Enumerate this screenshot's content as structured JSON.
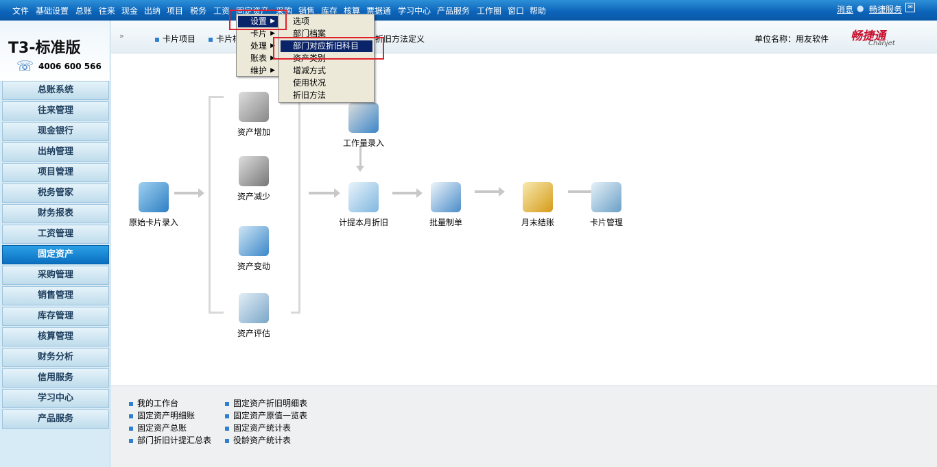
{
  "menubar": {
    "items": [
      "文件",
      "基础设置",
      "总账",
      "往来",
      "现金",
      "出纳",
      "项目",
      "税务",
      "工资",
      "固定资产",
      "采购",
      "销售",
      "库存",
      "核算",
      "票据通",
      "学习中心",
      "产品服务",
      "工作圈",
      "窗口",
      "帮助"
    ],
    "msg": "消息",
    "service": "畅捷服务"
  },
  "logo": {
    "title": "T3-标准版",
    "phone": "4006 600 566"
  },
  "sidebar": {
    "items": [
      "总账系统",
      "往来管理",
      "现金银行",
      "出纳管理",
      "项目管理",
      "税务管家",
      "财务报表",
      "工资管理",
      "固定资产",
      "采购管理",
      "销售管理",
      "库存管理",
      "核算管理",
      "财务分析",
      "信用服务",
      "学习中心",
      "产品服务"
    ],
    "active_index": 8
  },
  "toolbar": {
    "links": [
      "卡片项目",
      "卡片样式",
      "折旧方法定义"
    ],
    "unit_label": "单位名称：用友软件",
    "brand": "畅捷通",
    "brand_en": "Chanjet"
  },
  "flow": {
    "n1": "原始卡片录入",
    "n2": "资产增加",
    "n3": "资产减少",
    "n4": "资产变动",
    "n5": "资产评估",
    "n6": "工作量录入",
    "n7": "计提本月折旧",
    "n8": "批量制单",
    "n9": "月末结账",
    "n10": "卡片管理"
  },
  "reports": {
    "col1": [
      "我的工作台",
      "固定资产明细账",
      "固定资产总账",
      "部门折旧计提汇总表"
    ],
    "col2": [
      "固定资产折旧明细表",
      "固定资产原值一览表",
      "固定资产统计表",
      "役龄资产统计表"
    ]
  },
  "menu1": {
    "items": [
      "设置",
      "卡片",
      "处理",
      "账表",
      "维护"
    ]
  },
  "menu2": {
    "items": [
      "选项",
      "部门档案",
      "部门对应折旧科目",
      "资产类别",
      "增减方式",
      "使用状况",
      "折旧方法"
    ],
    "selected_index": 2
  }
}
